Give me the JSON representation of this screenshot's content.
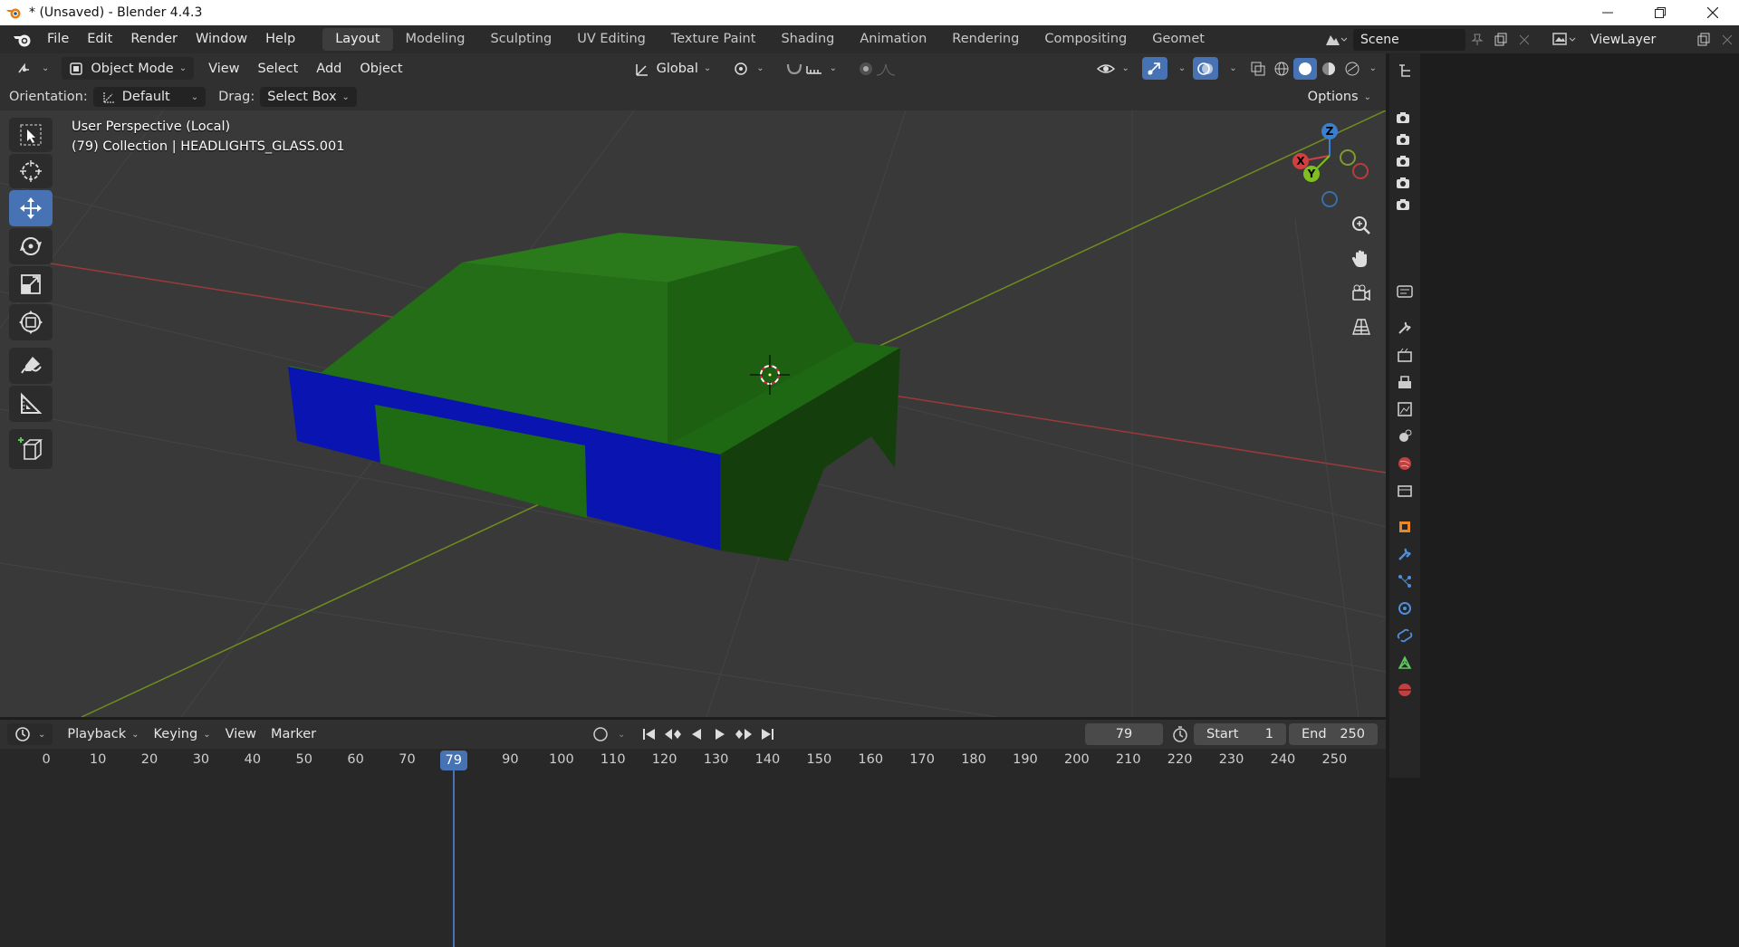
{
  "window": {
    "title": "* (Unsaved) - Blender 4.4.3",
    "controls": [
      "minimize-icon",
      "restore-icon",
      "close-icon"
    ]
  },
  "menu": {
    "items": [
      "File",
      "Edit",
      "Render",
      "Window",
      "Help"
    ]
  },
  "workspaces": {
    "tabs": [
      "Layout",
      "Modeling",
      "Sculpting",
      "UV Editing",
      "Texture Paint",
      "Shading",
      "Animation",
      "Rendering",
      "Compositing",
      "Geomet"
    ],
    "active": "Layout"
  },
  "scene": {
    "name": "Scene",
    "view_layer": "ViewLayer"
  },
  "viewport_header": {
    "mode": "Object Mode",
    "menus": [
      "View",
      "Select",
      "Add",
      "Object"
    ],
    "transform_orientation": "Global"
  },
  "tool_settings": {
    "orientation_label": "Orientation:",
    "orientation_value": "Default",
    "drag_label": "Drag:",
    "drag_value": "Select Box",
    "options_label": "Options"
  },
  "viewport": {
    "perspective_text": "User Perspective (Local)",
    "collection_text": "(79) Collection | HEADLIGHTS_GLASS.001",
    "gizmo_axes": {
      "x": "X",
      "y": "Y",
      "z": "Z"
    },
    "colors": {
      "background": "#393939",
      "green_face": "#1f6b14",
      "blue_face": "#0a14b0",
      "x_axis": "#b33a3a",
      "y_axis": "#7b9a1e"
    }
  },
  "toolbar": {
    "tools": [
      "select-box-icon",
      "cursor-icon",
      "move-icon",
      "rotate-icon",
      "scale-icon",
      "transform-icon",
      "annotate-icon",
      "measure-icon",
      "add-cube-icon"
    ],
    "active": "move-icon"
  },
  "timeline": {
    "menus": [
      "Playback",
      "Keying",
      "View",
      "Marker"
    ],
    "current_frame": "79",
    "start_label": "Start",
    "start_value": "1",
    "end_label": "End",
    "end_value": "250",
    "ruler": [
      "0",
      "10",
      "20",
      "30",
      "40",
      "50",
      "60",
      "70",
      "79",
      "90",
      "100",
      "110",
      "120",
      "130",
      "140",
      "150",
      "160",
      "170",
      "180",
      "190",
      "200",
      "210",
      "220",
      "230",
      "240",
      "250"
    ]
  }
}
